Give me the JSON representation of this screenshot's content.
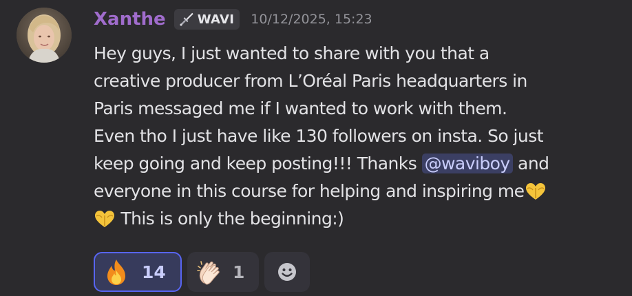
{
  "message": {
    "author": {
      "name": "Xanthe",
      "name_color": "#a06ccc",
      "tag_icon": "sword-icon",
      "tag_label": "WAVI"
    },
    "timestamp": "10/12/2025, 15:23",
    "content": {
      "line1": "Hey guys, I just wanted to share with you that a",
      "line2": "creative producer from L’Oréal Paris headquarters in",
      "line3": "Paris messaged me if I wanted to work with them.",
      "line4": "Even tho I just have like 130 followers on insta. So just",
      "line5_before": "keep going and keep posting!!! Thanks ",
      "mention": "@waviboy",
      "line5_after": " and",
      "line6": "everyone in this course for helping and inspiring me",
      "line7": " This is only the beginning:)",
      "heart_icon": "heart-hands-emoji-icon"
    },
    "reactions": [
      {
        "emoji": "fire-emoji-icon",
        "count": "14",
        "active": true
      },
      {
        "emoji": "clapping-hands-emoji-icon",
        "count": "1",
        "active": false
      }
    ],
    "add_reaction_icon": "add-reaction-smiley-icon"
  },
  "colors": {
    "background": "#2b2a2d",
    "mention_bg": "#3b3f63",
    "mention_text": "#c9cdfb",
    "reaction_active_border": "#5865f2"
  }
}
